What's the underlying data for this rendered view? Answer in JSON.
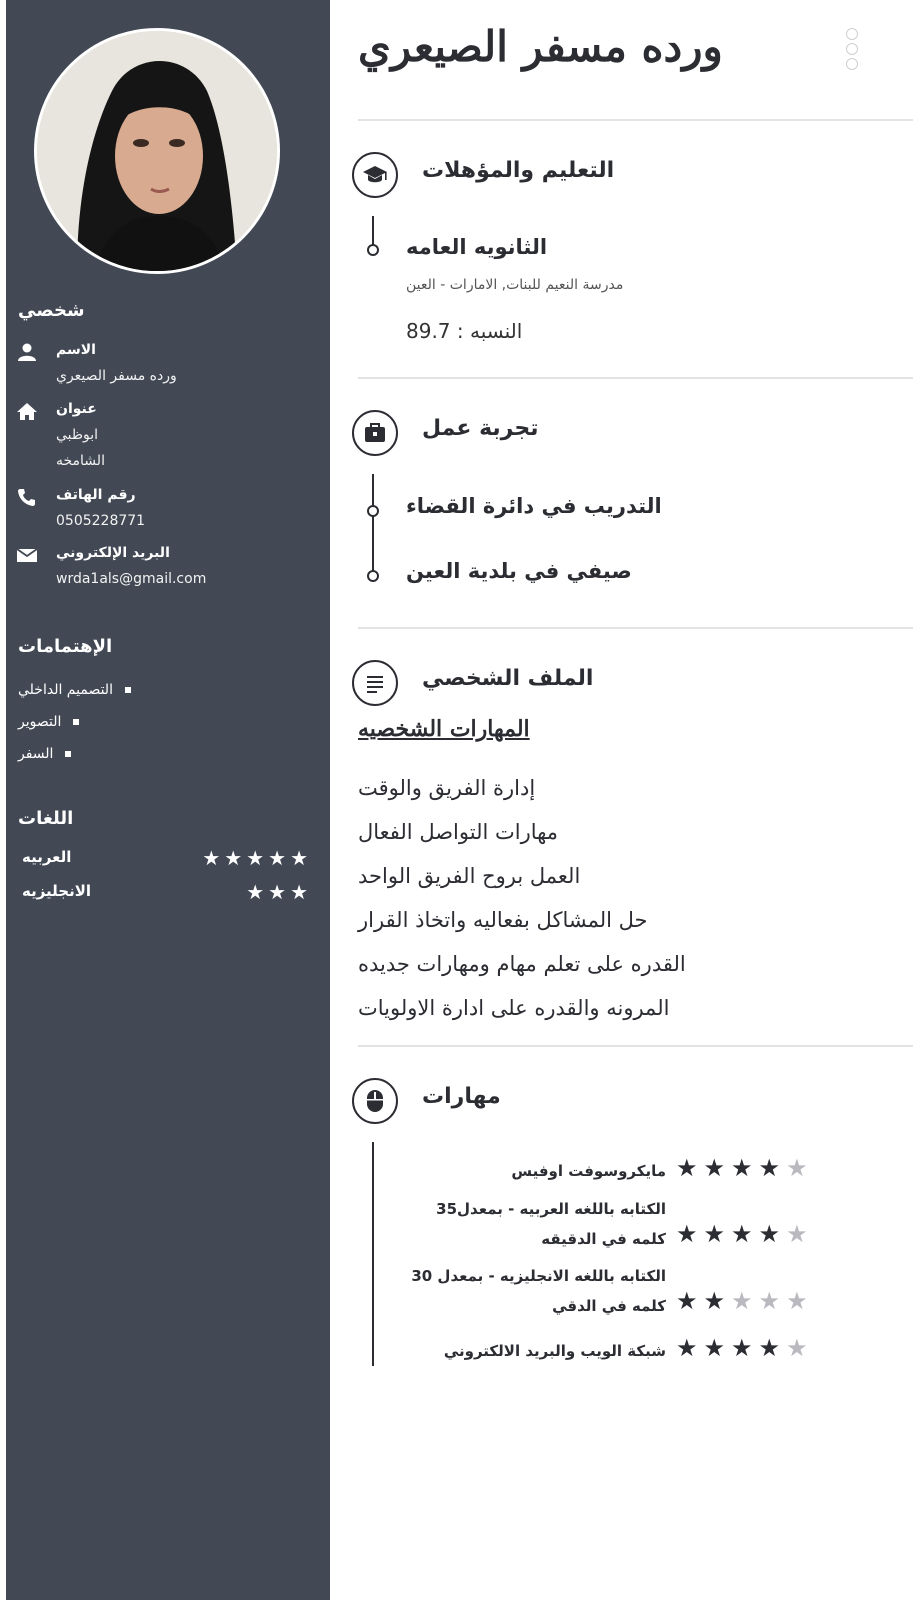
{
  "name": "ورده مسفر الصيعري",
  "personal": {
    "heading": "شخصي",
    "name_label": "الاسم",
    "name_value": "ورده مسفر الصيعري",
    "address_label": "عنوان",
    "address_line1": "ابوظبي",
    "address_line2": "الشامخه",
    "phone_label": "رقم الهاتف",
    "phone_value": "0505228771",
    "email_label": "البريد الإلكتروني",
    "email_value": "wrda1als@gmail.com"
  },
  "interests": {
    "heading": "الإهتمامات",
    "items": [
      "التصميم الداخلي",
      "التصوير",
      "السفر"
    ]
  },
  "languages": {
    "heading": "اللغات",
    "items": [
      {
        "name": "العربيه",
        "rating": 5
      },
      {
        "name": "الانجليزيه",
        "rating": 3
      }
    ]
  },
  "education": {
    "title": "التعليم والمؤهلات",
    "items": [
      {
        "title": "الثانويه العامه",
        "school": "مدرسة النعيم للبنات, الامارات - العين",
        "grade": "النسبه : 89.7"
      }
    ]
  },
  "experience": {
    "title": "تجربة عمل",
    "items": [
      "التدريب في دائرة القضاء",
      "صيفي في بلدية العين"
    ]
  },
  "profile": {
    "title": "الملف الشخصي",
    "subheading": "المهارات الشخصيه",
    "lines": [
      "إدارة الفريق والوقت",
      "مهارات التواصل الفعال",
      "العمل بروح الفريق الواحد",
      "حل المشاكل بفعاليه واتخاذ القرار",
      "القدره على تعلم مهام ومهارات جديده",
      "المرونه والقدره على ادارة الاولويات"
    ]
  },
  "skills": {
    "title": "مهارات",
    "items": [
      {
        "label": "مايكروسوفت اوفيس",
        "rating": 4
      },
      {
        "label": "الكتابه باللغه العربيه - بمعدل35 كلمه في الدقيقه",
        "rating": 4
      },
      {
        "label": "الكتابه باللغه الانجليزيه - بمعدل 30 كلمه في الدقي",
        "rating": 2
      },
      {
        "label": "شبكة الويب والبريد الالكتروني",
        "rating": 4
      }
    ]
  },
  "colors": {
    "sidebar": "#424955",
    "text": "#2b2d33",
    "star_off": "#b9b9bf"
  },
  "icons": {
    "education": "graduation-cap-icon",
    "experience": "briefcase-icon",
    "profile": "document-lines-icon",
    "skills": "mouse-icon"
  }
}
